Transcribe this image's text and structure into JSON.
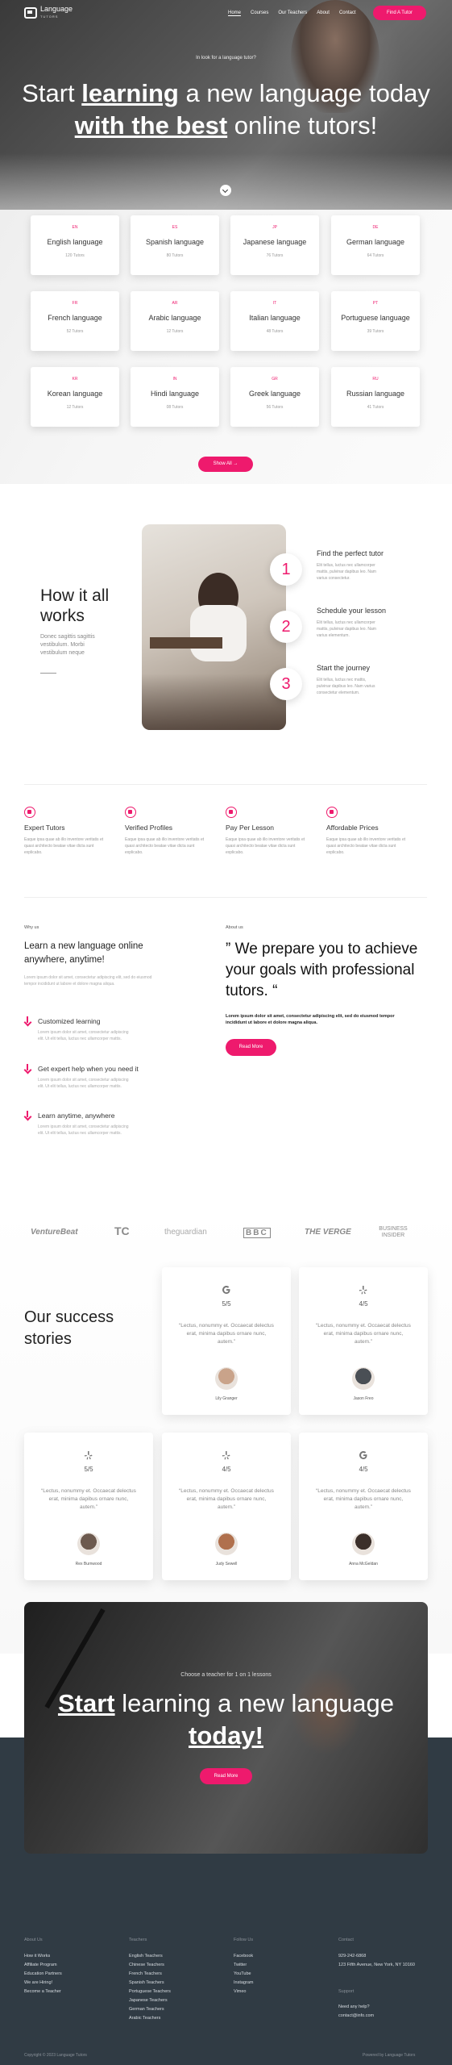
{
  "header": {
    "logo_text": "Language",
    "logo_sub": "TUTORS",
    "menu": [
      "Home",
      "Courses",
      "Our Teachers",
      "About",
      "Contact"
    ],
    "find_button": "Find A Tutor"
  },
  "hero": {
    "kicker": "In look for a language tutor?",
    "title_1": "Start ",
    "title_bold_1": "learning",
    "title_2": " a new language today",
    "title_bold_2": "with the best",
    "title_3": " online tutors!"
  },
  "languages": [
    {
      "code": "EN",
      "name": "English language",
      "count": "120 Tutors"
    },
    {
      "code": "ES",
      "name": "Spanish language",
      "count": "80 Tutors"
    },
    {
      "code": "JP",
      "name": "Japanese language",
      "count": "76 Tutors"
    },
    {
      "code": "DE",
      "name": "German language",
      "count": "64 Tutors"
    },
    {
      "code": "FR",
      "name": "French language",
      "count": "52 Tutors"
    },
    {
      "code": "AR",
      "name": "Arabic language",
      "count": "12 Tutors"
    },
    {
      "code": "IT",
      "name": "Italian language",
      "count": "48 Tutors"
    },
    {
      "code": "PT",
      "name": "Portuguese language",
      "count": "39 Tutors"
    },
    {
      "code": "KR",
      "name": "Korean language",
      "count": "12 Tutors"
    },
    {
      "code": "IN",
      "name": "Hindi language",
      "count": "08 Tutors"
    },
    {
      "code": "GR",
      "name": "Greek language",
      "count": "56 Tutors"
    },
    {
      "code": "RU",
      "name": "Russian language",
      "count": "41 Tutors"
    }
  ],
  "show_all": "Show All",
  "how": {
    "title": "How it all works",
    "text": "Donec sagittis sagittis vestibulum. Morbi vestibulum neque",
    "steps": [
      {
        "num": "1",
        "title": "Find the perfect tutor",
        "text": "Elit tellus, luctus nec ullamcorper mattis, pulvinar dapibus leo. Nam varius consectetur."
      },
      {
        "num": "2",
        "title": "Schedule your lesson",
        "text": "Elit tellus, luctus nec ullamcorper mattis, pulvinar dapibus leo. Nam varius elementum."
      },
      {
        "num": "3",
        "title": "Start the journey",
        "text": "Elit tellus, luctus nec mattis, pulvinar dapibus leo. Nam varius consectetur elementum."
      }
    ]
  },
  "features": [
    {
      "title": "Expert Tutors",
      "text": "Eaque ipsa quae ab illo inventore veritatis et quasi architecto beatae vitae dicta sunt explicabo."
    },
    {
      "title": "Verified Profiles",
      "text": "Eaque ipsa quae ab illo inventore veritatis et quasi architecto beatae vitae dicta sunt explicabo."
    },
    {
      "title": "Pay Per Lesson",
      "text": "Eaque ipsa quae ab illo inventore veritatis et quasi architecto beatae vitae dicta sunt explicabo."
    },
    {
      "title": "Affordable Prices",
      "text": "Eaque ipsa quae ab illo inventore veritatis et quasi architecto beatae vitae dicta sunt explicabo."
    }
  ],
  "why": {
    "label": "Why us",
    "title": "Learn a new language online anywhere, anytime!",
    "text": "Lorem ipsum dolor sit amet, consectetur adipiscing elit, sed do eiusmod tempor incididunt ut labore et dolore magna aliqua.",
    "items": [
      {
        "title": "Customized learning",
        "text": "Lorem ipsum dolor sit amet, consectetur adipiscing elit. Ut elit tellus, luctus nec ullamcorper mattis."
      },
      {
        "title": "Get expert help when you need it",
        "text": "Lorem ipsum dolor sit amet, consectetur adipiscing elit. Ut elit tellus, luctus nec ullamcorper mattis."
      },
      {
        "title": "Learn anytime, anywhere",
        "text": "Lorem ipsum dolor sit amet, consectetur adipiscing elit. Ut elit tellus, luctus nec ullamcorper mattis."
      }
    ]
  },
  "about": {
    "label": "About us",
    "quote": "” We prepare you to achieve your goals with professional tutors. “",
    "bold_text": "Lorem ipsum dolor sit amet, consectetur adipiscing elit, sed do eiusmod tempor incididunt ut labore et dolore magna aliqua.",
    "button": "Read More"
  },
  "brands": [
    "VentureBeat",
    "TC",
    "theguardian",
    "BBC",
    "THE VERGE",
    "BUSINESS INSIDER"
  ],
  "success": {
    "title": "Our success stories",
    "testimonials": [
      {
        "icon": "google-icon",
        "rating": "5/5",
        "quote": "“Lectus, nonummy et. Occaecat delectus erat, minima dapibus ornare nunc, autem.”",
        "name": "Lily Granger",
        "avatar": "#c9a38a"
      },
      {
        "icon": "yelp-icon",
        "rating": "4/5",
        "quote": "“Lectus, nonummy et. Occaecat delectus erat, minima dapibus ornare nunc, autem.”",
        "name": "Jason Freo",
        "avatar": "#4a4f55"
      },
      {
        "icon": "yelp-icon",
        "rating": "5/5",
        "quote": "“Lectus, nonummy et. Occaecat delectus erat, minima dapibus ornare nunc, autem.”",
        "name": "Rex Burnwood",
        "avatar": "#6d5a4f"
      },
      {
        "icon": "yelp-icon",
        "rating": "4/5",
        "quote": "“Lectus, nonummy et. Occaecat delectus erat, minima dapibus ornare nunc, autem.”",
        "name": "Judy Sewell",
        "avatar": "#b0704d"
      },
      {
        "icon": "google-icon",
        "rating": "4/5",
        "quote": "“Lectus, nonummy et. Occaecat delectus erat, minima dapibus ornare nunc, autem.”",
        "name": "Anna McGeldan",
        "avatar": "#3b2f2a"
      }
    ]
  },
  "cta": {
    "kicker": "Choose a teacher for 1 on 1 lessons",
    "title_bold_1": "Start",
    "title_1": " learning a new language ",
    "title_bold_2": "today!",
    "button": "Read More"
  },
  "footer": {
    "col1": {
      "head": "About Us",
      "links": [
        "How it Works",
        "Affiliate Program",
        "Education Partners",
        "We are Hiring!",
        "Become a Teacher"
      ]
    },
    "col2": {
      "head": "Teachers",
      "links": [
        "English Teachers",
        "Chinese Teachers",
        "French Teachers",
        "Spanish Teachers",
        "Portuguese Teachers",
        "Japanese Teachers",
        "German Teachers",
        "Arabic Teachers"
      ]
    },
    "col3": {
      "head": "Follow Us",
      "links": [
        "Facebook",
        "Twitter",
        "YouTube",
        "Instagram",
        "Vimeo"
      ]
    },
    "col4": {
      "head": "Contact",
      "phone": "929-242-6868",
      "address": "123 Fifth Avenue, New York, NY 10160",
      "support_head": "Support",
      "need_help": "Need any help?",
      "email": "contact@info.com"
    },
    "copyright": "Copyright © 2023 Language Tutors",
    "powered": "Powered by Language Tutors"
  },
  "colors": {
    "accent": "#ee1a6d",
    "footer_bg": "#303b44"
  }
}
